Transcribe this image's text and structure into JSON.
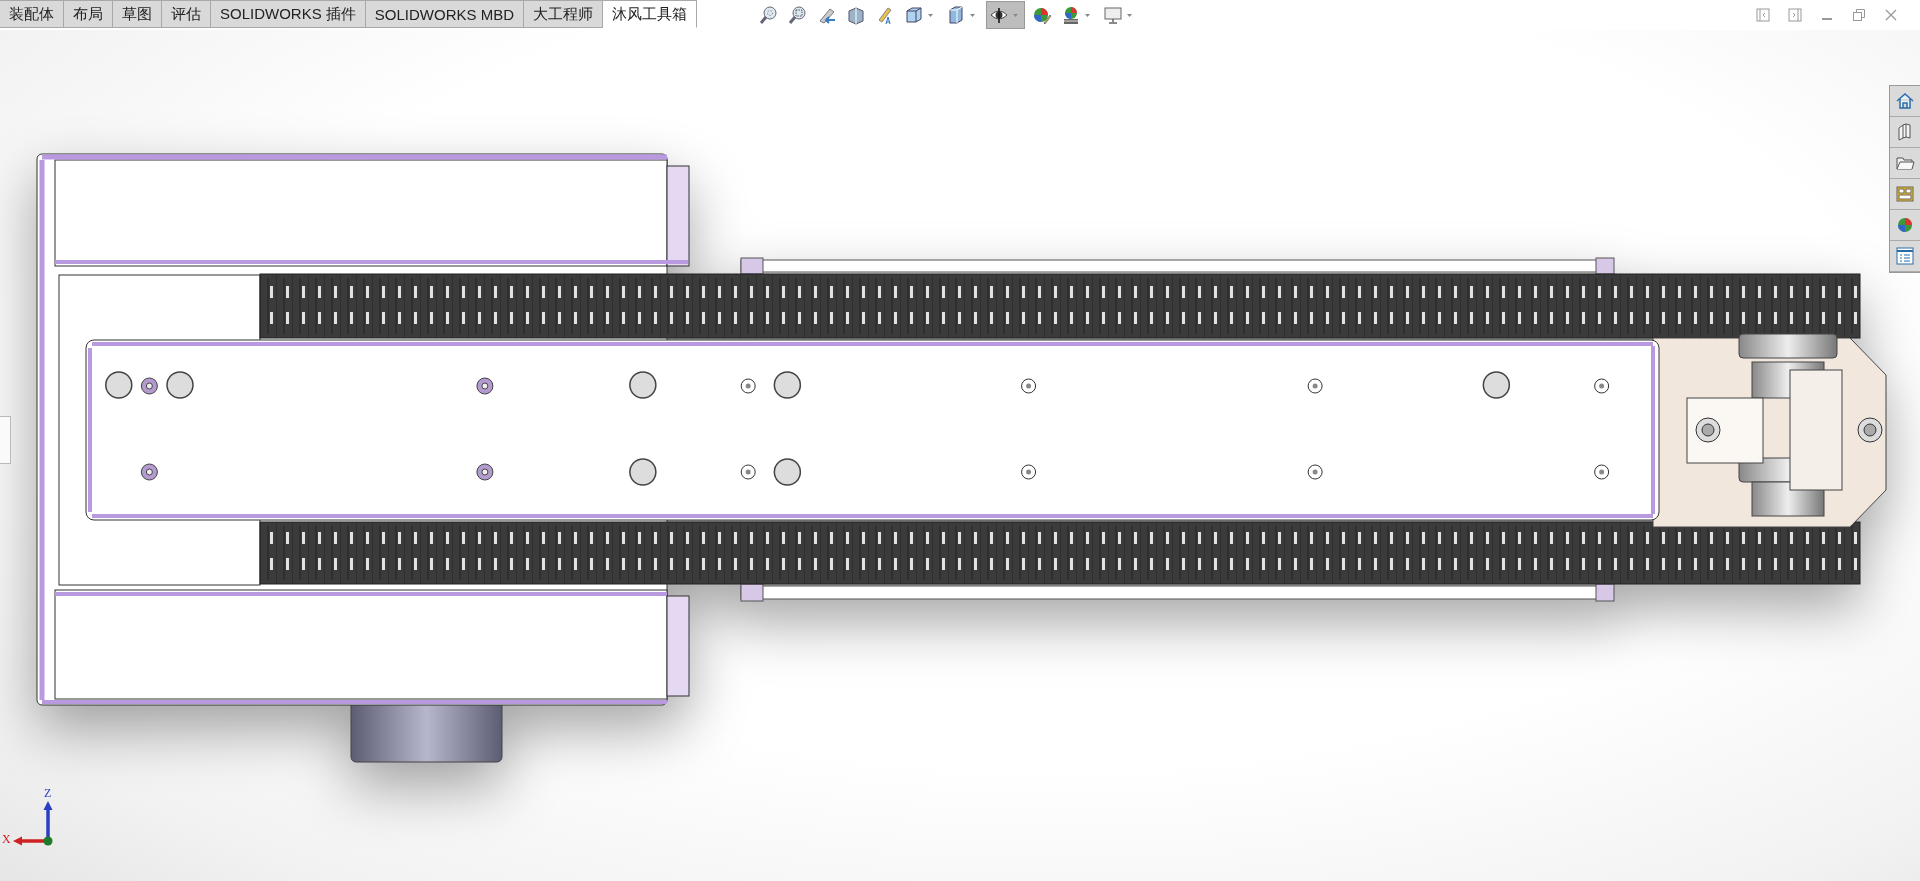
{
  "tabs": [
    {
      "label": "装配体",
      "selected": false
    },
    {
      "label": "布局",
      "selected": false
    },
    {
      "label": "草图",
      "selected": false
    },
    {
      "label": "评估",
      "selected": false
    },
    {
      "label": "SOLIDWORKS 插件",
      "selected": false
    },
    {
      "label": "SOLIDWORKS MBD",
      "selected": false
    },
    {
      "label": "大工程师",
      "selected": false
    },
    {
      "label": "沐风工具箱",
      "selected": true
    }
  ],
  "view_toolbar": [
    {
      "kind": "zoom-fit",
      "pressed": false,
      "dropdown": false
    },
    {
      "kind": "zoom-area",
      "pressed": false,
      "dropdown": false
    },
    {
      "kind": "previous",
      "pressed": false,
      "dropdown": false
    },
    {
      "kind": "section",
      "pressed": false,
      "dropdown": false
    },
    {
      "kind": "annotation",
      "pressed": false,
      "dropdown": false
    },
    {
      "kind": "orientation",
      "pressed": false,
      "dropdown": true
    },
    {
      "kind": "display",
      "pressed": false,
      "dropdown": true
    },
    {
      "kind": "hide-show",
      "pressed": true,
      "dropdown": true
    },
    {
      "kind": "appearance",
      "pressed": false,
      "dropdown": false
    },
    {
      "kind": "scene",
      "pressed": false,
      "dropdown": true
    },
    {
      "kind": "monitor",
      "pressed": false,
      "dropdown": true
    }
  ],
  "triad": {
    "x_label": "X",
    "z_label": "Z"
  }
}
